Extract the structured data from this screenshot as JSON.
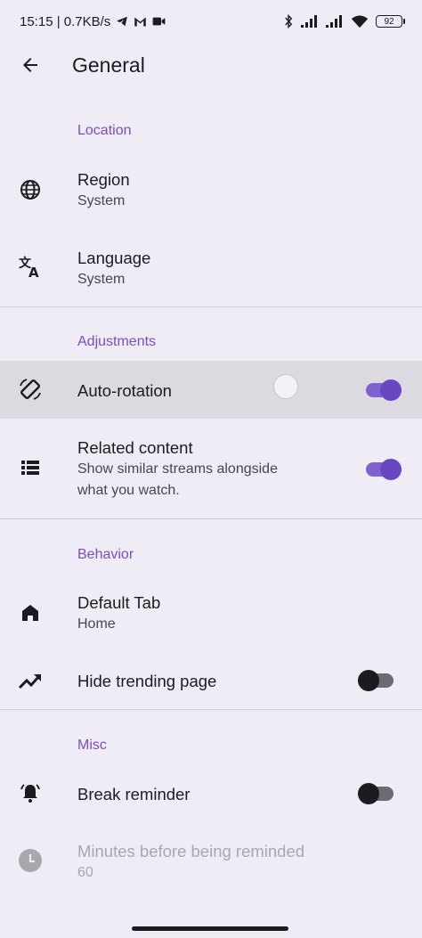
{
  "status": {
    "time_speed": "15:15 | 0.7KB/s",
    "battery": "92"
  },
  "appbar": {
    "title": "General"
  },
  "sections": {
    "location": "Location",
    "adjustments": "Adjustments",
    "behavior": "Behavior",
    "misc": "Misc"
  },
  "rows": {
    "region": {
      "title": "Region",
      "summary": "System"
    },
    "language": {
      "title": "Language",
      "summary": "System"
    },
    "auto_rotation": {
      "title": "Auto-rotation",
      "enabled": true
    },
    "related": {
      "title": "Related content",
      "summary1": "Show similar streams alongside",
      "summary2": "what you watch.",
      "enabled": true
    },
    "default_tab": {
      "title": "Default Tab",
      "summary": "Home"
    },
    "hide_trending": {
      "title": "Hide trending page",
      "enabled": false
    },
    "break_reminder": {
      "title": "Break reminder",
      "enabled": false
    },
    "minutes": {
      "title": "Minutes before being reminded",
      "summary": "60"
    }
  },
  "colors": {
    "accent": "#7a4fbd",
    "switch_on": "#6a47c2",
    "background": "#efecf5"
  },
  "icons": [
    "back-arrow-icon",
    "globe-icon",
    "translate-icon",
    "screen-rotation-icon",
    "list-icon",
    "home-icon",
    "trending-icon",
    "alarm-bell-icon",
    "clock-icon"
  ]
}
